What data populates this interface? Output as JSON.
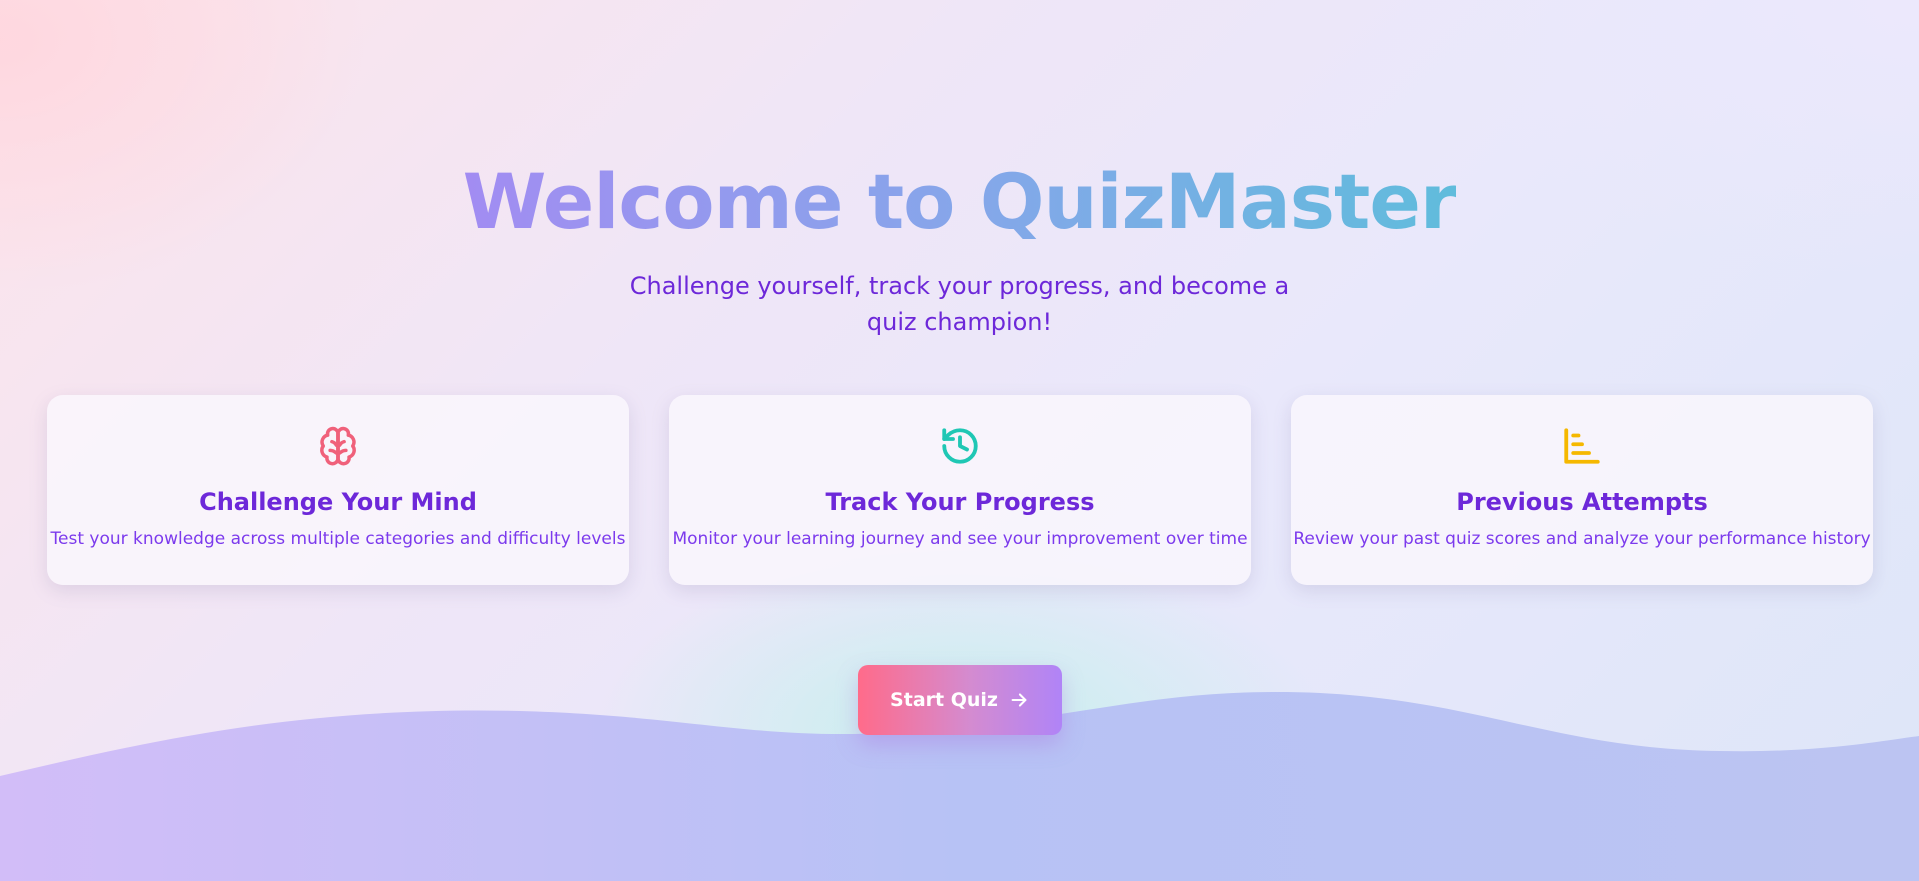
{
  "hero": {
    "title": "Welcome to QuizMaster",
    "subtitle": "Challenge yourself, track your progress, and become a quiz champion!"
  },
  "cards": [
    {
      "icon": "brain-icon",
      "title": "Challenge Your Mind",
      "description": "Test your knowledge across multiple categories and difficulty levels",
      "color": "#f0607a"
    },
    {
      "icon": "history-icon",
      "title": "Track Your Progress",
      "description": "Monitor your learning journey and see your improvement over time",
      "color": "#1fc7b4"
    },
    {
      "icon": "bar-chart-icon",
      "title": "Previous Attempts",
      "description": "Review your past quiz scores and analyze your performance history",
      "color": "#f5b800"
    }
  ],
  "cta": {
    "label": "Start Quiz",
    "icon": "arrow-right-icon"
  },
  "colors": {
    "heading_text": "#6d28d9",
    "body_text": "#7c3aed",
    "button_gradient_start": "#ff6b8a",
    "button_gradient_end": "#b084f7"
  }
}
